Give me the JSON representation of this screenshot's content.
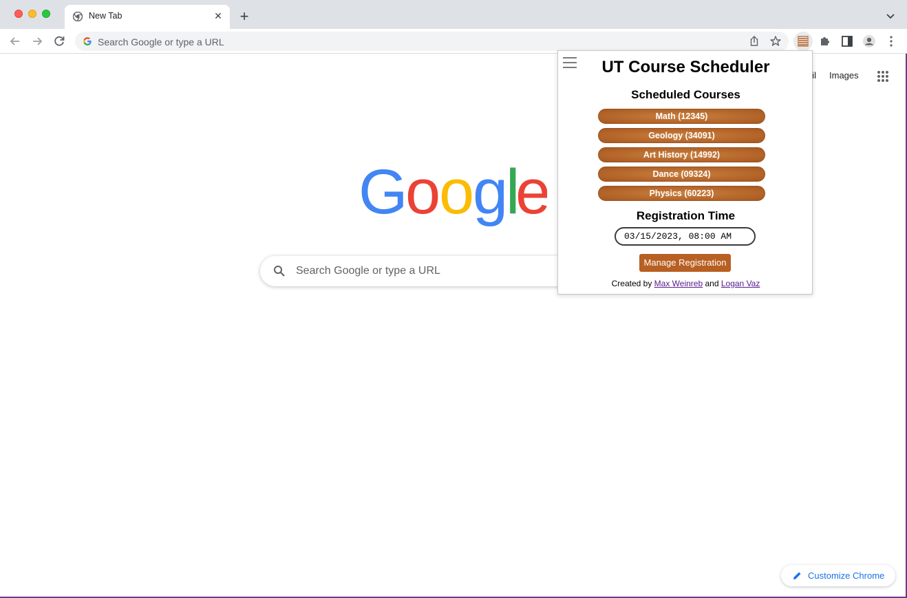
{
  "browser": {
    "tab": {
      "title": "New Tab",
      "close_glyph": "✕"
    },
    "new_tab_glyph": "+",
    "omnibox": {
      "placeholder": "Search Google or type a URL"
    },
    "icons": [
      "back-icon",
      "forward-icon",
      "reload-icon",
      "share-icon",
      "bookmark-star-icon",
      "extension-scheduler-icon",
      "extensions-puzzle-icon",
      "side-panel-icon",
      "profile-icon",
      "menu-kebab-icon"
    ]
  },
  "ntp": {
    "links": {
      "gmail_partial": "ail",
      "images": "Images"
    },
    "logo_letters": [
      "G",
      "o",
      "o",
      "g",
      "l",
      "e"
    ],
    "search_placeholder": "Search Google or type a URL",
    "customize_label": "Customize Chrome"
  },
  "popup": {
    "title": "UT Course Scheduler",
    "scheduled_heading": "Scheduled Courses",
    "courses": [
      "Math (12345)",
      "Geology (34091)",
      "Art History (14992)",
      "Dance (09324)",
      "Physics (60223)"
    ],
    "registration_heading": "Registration Time",
    "registration_value": "03/15/2023, 08:00 AM",
    "manage_button": "Manage Registration",
    "credits": {
      "prefix": "Created by ",
      "author1": "Max Weinreb",
      "joiner": " and ",
      "author2": "Logan Vaz"
    }
  },
  "colors": {
    "accent_burnt_orange": "#b85f22",
    "google_blue": "#4285f4",
    "google_red": "#ea4335",
    "google_yellow": "#fbbc05",
    "google_green": "#34a853"
  }
}
